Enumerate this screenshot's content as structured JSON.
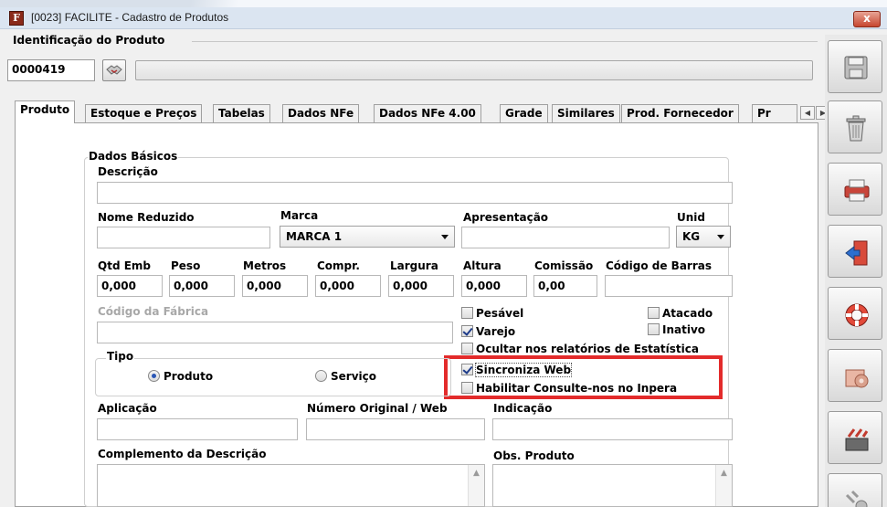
{
  "window": {
    "title": "[0023] FACILITE - Cadastro de Produtos",
    "app_icon_letter": "F",
    "close_label": "x"
  },
  "identification": {
    "section_title": "Identificação do Produto",
    "code": "0000419",
    "description": ""
  },
  "tabs": [
    {
      "label": "Produto",
      "active": true
    },
    {
      "label": "Estoque e Preços",
      "active": false
    },
    {
      "label": "Tabelas",
      "active": false
    },
    {
      "label": "Dados NFe",
      "active": false
    },
    {
      "label": "Dados NFe 4.00",
      "active": false
    },
    {
      "label": "Grade",
      "active": false
    },
    {
      "label": "Similares",
      "active": false
    },
    {
      "label": "Prod. Fornecedor",
      "active": false
    },
    {
      "label": "Pr",
      "active": false
    }
  ],
  "dados_basicos": {
    "group_title": "Dados Básicos",
    "descricao_label": "Descrição",
    "descricao_value": "",
    "nome_reduzido_label": "Nome Reduzido",
    "nome_reduzido_value": "",
    "marca_label": "Marca",
    "marca_value": "MARCA 1",
    "apresentacao_label": "Apresentação",
    "apresentacao_value": "",
    "unid_label": "Unid",
    "unid_value": "KG",
    "qtd_emb_label": "Qtd Emb",
    "qtd_emb_value": "0,000",
    "peso_label": "Peso",
    "peso_value": "0,000",
    "metros_label": "Metros",
    "metros_value": "0,000",
    "compr_label": "Compr.",
    "compr_value": "0,000",
    "largura_label": "Largura",
    "largura_value": "0,000",
    "altura_label": "Altura",
    "altura_value": "0,000",
    "comissao_label": "Comissão",
    "comissao_value": "0,00",
    "codigo_barras_label": "Código de Barras",
    "codigo_barras_value": "",
    "codigo_fabrica_label": "Código da Fábrica",
    "codigo_fabrica_value": ""
  },
  "checkboxes": {
    "pesavel": {
      "label": "Pesável",
      "checked": false
    },
    "atacado": {
      "label": "Atacado",
      "checked": false
    },
    "varejo": {
      "label": "Varejo",
      "checked": true
    },
    "inativo": {
      "label": "Inativo",
      "checked": false
    },
    "ocultar": {
      "label": "Ocultar nos relatórios de Estatística",
      "checked": false
    },
    "sincroniza": {
      "label": "Sincroniza Web",
      "checked": true
    },
    "consulte": {
      "label": "Habilitar Consulte-nos no Inpera",
      "checked": false
    }
  },
  "tipo": {
    "group_title": "Tipo",
    "produto_label": "Produto",
    "servico_label": "Serviço",
    "selected": "Produto"
  },
  "lower": {
    "aplicacao_label": "Aplicação",
    "aplicacao_value": "",
    "numero_original_label": "Número Original / Web",
    "numero_original_value": "",
    "indicacao_label": "Indicação",
    "indicacao_value": "",
    "complemento_label": "Complemento da Descrição",
    "obs_label": "Obs. Produto"
  },
  "sidebar": [
    "save-icon",
    "trash-icon",
    "print-icon",
    "exit-icon",
    "lifebuoy-icon",
    "settings-icon",
    "tools-icon",
    "tools2-icon"
  ],
  "colors": {
    "highlight": "#e32b2b",
    "titlebar": "#dbe5f1"
  }
}
